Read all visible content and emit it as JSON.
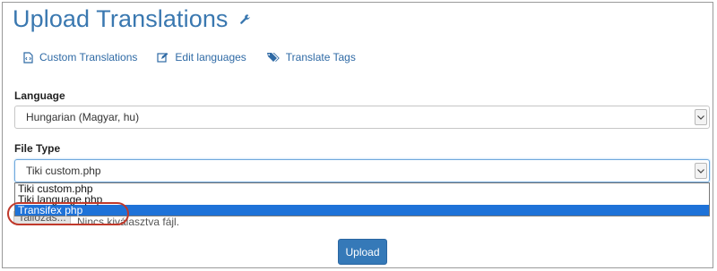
{
  "page": {
    "title": "Upload Translations",
    "title_icon": "wrench-icon"
  },
  "nav_links": [
    {
      "label": "Custom Translations",
      "icon": "code-file-icon"
    },
    {
      "label": "Edit languages",
      "icon": "edit-icon"
    },
    {
      "label": "Translate Tags",
      "icon": "tags-icon"
    }
  ],
  "language": {
    "label": "Language",
    "value": "Hungarian (Magyar, hu)"
  },
  "file_type": {
    "label": "File Type",
    "value": "Tiki custom.php",
    "options": [
      "Tiki custom.php",
      "Tiki language.php",
      "Transifex php"
    ],
    "highlighted_option": "Transifex php"
  },
  "file_input": {
    "button": "Tallózás...",
    "status": "Nincs kiválasztva fájl."
  },
  "upload_button": "Upload",
  "colors": {
    "accent": "#3a78b0",
    "highlight": "#1e72d8",
    "annotation": "#c0392b",
    "button": "#3579b8"
  }
}
